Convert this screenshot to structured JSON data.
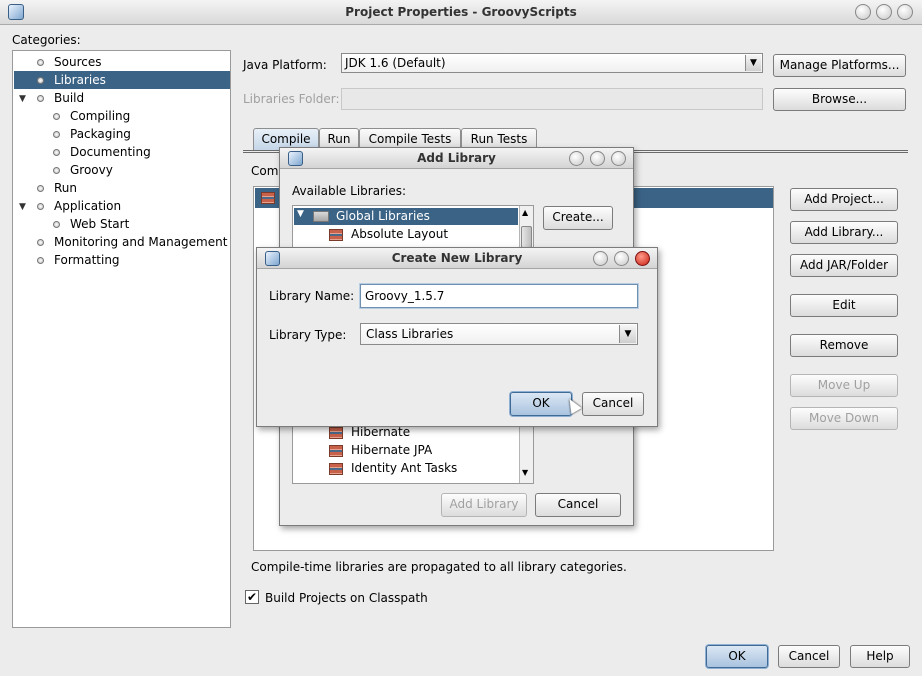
{
  "window": {
    "title": "Project Properties - GroovyScripts"
  },
  "categories": {
    "label": "Categories:",
    "items": [
      {
        "label": "Sources"
      },
      {
        "label": "Libraries"
      },
      {
        "label": "Build"
      },
      {
        "label": "Compiling"
      },
      {
        "label": "Packaging"
      },
      {
        "label": "Documenting"
      },
      {
        "label": "Groovy"
      },
      {
        "label": "Run"
      },
      {
        "label": "Application"
      },
      {
        "label": "Web Start"
      },
      {
        "label": "Monitoring and Management"
      },
      {
        "label": "Formatting"
      }
    ],
    "selected": "Libraries"
  },
  "libraries": {
    "java_platform_label": "Java Platform:",
    "java_platform_value": "JDK 1.6 (Default)",
    "manage_platforms": "Manage Platforms...",
    "libraries_folder_label": "Libraries Folder:",
    "browse": "Browse...",
    "tabs": [
      "Compile",
      "Run",
      "Compile Tests",
      "Run Tests"
    ],
    "compile_label_partial": "Com",
    "buttons": {
      "add_project": "Add Project...",
      "add_library": "Add Library...",
      "add_jar": "Add JAR/Folder",
      "edit": "Edit",
      "remove": "Remove",
      "move_up": "Move Up",
      "move_down": "Move Down"
    },
    "note": "Compile-time libraries are propagated to all library categories.",
    "build_on_classpath": "Build Projects on Classpath"
  },
  "footer": {
    "ok": "OK",
    "cancel": "Cancel",
    "help": "Help"
  },
  "add_library_dialog": {
    "title": "Add Library",
    "available_label": "Available Libraries:",
    "tree_root": "Global Libraries",
    "items_top": [
      "Absolute Layout"
    ],
    "items_bottom": [
      "Hibernate",
      "Hibernate JPA",
      "Identity Ant Tasks"
    ],
    "create": "Create...",
    "add_library": "Add Library",
    "cancel": "Cancel"
  },
  "create_library_dialog": {
    "title": "Create New Library",
    "name_label": "Library Name:",
    "name_value": "Groovy_1.5.7",
    "type_label": "Library Type:",
    "type_value": "Class Libraries",
    "ok": "OK",
    "cancel": "Cancel"
  }
}
